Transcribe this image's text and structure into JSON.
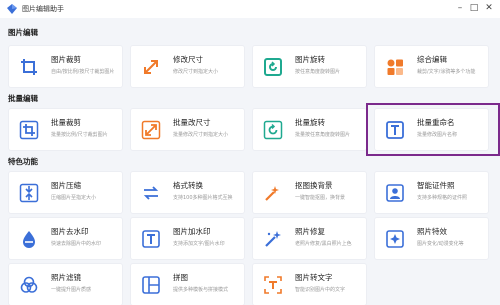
{
  "window": {
    "title": "图片编辑助手",
    "controls": {
      "minimize": "–",
      "maximize": "□",
      "close": "✕"
    }
  },
  "sections": [
    {
      "title": "图片编辑",
      "cards": [
        {
          "name": "图片裁剪",
          "desc": "自由/按比例/按尺寸裁剪图片",
          "icon": "crop-icon"
        },
        {
          "name": "修改尺寸",
          "desc": "修改尺寸到指定大小",
          "icon": "resize-icon"
        },
        {
          "name": "图片旋转",
          "desc": "按任意角度旋转图片",
          "icon": "rotate-icon"
        },
        {
          "name": "综合编辑",
          "desc": "裁剪/文字/涂鸦等多个功能",
          "icon": "multi-edit-icon"
        }
      ]
    },
    {
      "title": "批量编辑",
      "cards": [
        {
          "name": "批量裁剪",
          "desc": "批量按比例/尺寸裁剪图片",
          "icon": "batch-crop-icon"
        },
        {
          "name": "批量改尺寸",
          "desc": "批量修改尺寸到指定大小",
          "icon": "batch-resize-icon"
        },
        {
          "name": "批量旋转",
          "desc": "批量按任意角度旋转图片",
          "icon": "batch-rotate-icon"
        },
        {
          "name": "批量重命名",
          "desc": "批量修改图片名称",
          "icon": "batch-rename-icon"
        }
      ]
    },
    {
      "title": "特色功能",
      "cards": [
        {
          "name": "图片压缩",
          "desc": "压缩图片至指定大小",
          "icon": "compress-icon"
        },
        {
          "name": "格式转换",
          "desc": "支持100多种图片格式互换",
          "icon": "format-convert-icon"
        },
        {
          "name": "抠图换背景",
          "desc": "一键智能抠图，换背景",
          "icon": "cutout-icon"
        },
        {
          "name": "智能证件照",
          "desc": "支持多种规格的证件照",
          "icon": "id-photo-icon"
        },
        {
          "name": "图片去水印",
          "desc": "快速去除图片中的水印",
          "icon": "remove-watermark-icon"
        },
        {
          "name": "图片加水印",
          "desc": "支持添加文字/图片水印",
          "icon": "add-watermark-icon"
        },
        {
          "name": "照片修复",
          "desc": "老照片修复/黑白照片上色",
          "icon": "photo-repair-icon"
        },
        {
          "name": "照片特效",
          "desc": "图片变化/动漫变化等",
          "icon": "photo-effect-icon"
        },
        {
          "name": "照片滤镜",
          "desc": "一键提升图片质感",
          "icon": "filter-icon"
        },
        {
          "name": "拼图",
          "desc": "提供多种模板与拼接模式",
          "icon": "collage-icon"
        },
        {
          "name": "图片转文字",
          "desc": "智能识别图片中的文字",
          "icon": "ocr-icon"
        }
      ]
    }
  ],
  "colors": {
    "accent": "#3b6fd8",
    "orange": "#f07a2a",
    "green": "#1fa990",
    "highlight": "#7b2a8c"
  }
}
